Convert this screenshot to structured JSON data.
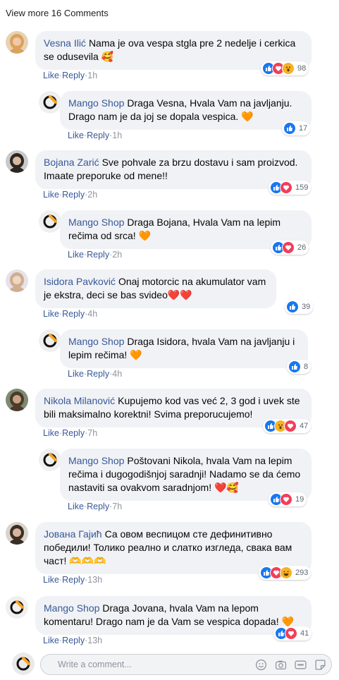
{
  "view_more_label": "View more 16 Comments",
  "action_labels": {
    "like": "Like",
    "reply": "Reply",
    "separator": "·"
  },
  "comments": [
    {
      "author": "Vesna Ilić",
      "text": "Nama je ova vespa stgla pre 2 nedelje i cerkica se odusevila 🥰",
      "time": "1h",
      "reactions": [
        "like",
        "love",
        "wow"
      ],
      "count": "98",
      "avatar": "woman-blonde"
    },
    {
      "author": "Mango Shop",
      "text": "Draga Vesna, Hvala Vam na javljanju. Drago nam je da joj se dopala vespica. 🧡",
      "time": "1h",
      "reactions": [
        "like"
      ],
      "count": "17",
      "avatar": "mango"
    },
    {
      "author": "Bojana Zarić",
      "text": "Sve pohvale za brzu dostavu i sam proizvod. Imaate preporuke od mene!!",
      "time": "2h",
      "reactions": [
        "like",
        "love"
      ],
      "count": "159",
      "avatar": "woman-dark"
    },
    {
      "author": "Mango Shop",
      "text": "Draga Bojana, Hvala Vam na lepim rečima od srca! 🧡",
      "time": "2h",
      "reactions": [
        "like",
        "love"
      ],
      "count": "26",
      "avatar": "mango"
    },
    {
      "author": "Isidora Pavković",
      "text": "Onaj motorcic na akumulator vam je ekstra, deci se bas svideo❤️❤️",
      "time": "4h",
      "reactions": [
        "like"
      ],
      "count": "39",
      "avatar": "woman-light"
    },
    {
      "author": "Mango Shop",
      "text": "Draga Isidora, hvala Vam na javljanju i lepim rečima! 🧡",
      "time": "4h",
      "reactions": [
        "like"
      ],
      "count": "8",
      "avatar": "mango"
    },
    {
      "author": "Nikola Milanović",
      "text": "Kupujemo kod vas već 2, 3 god i uvek ste bili maksimalno korektni! Svima preporucujemo!",
      "time": "7h",
      "reactions": [
        "like",
        "wow",
        "love"
      ],
      "count": "47",
      "avatar": "man"
    },
    {
      "author": "Mango Shop",
      "text": "Poštovani Nikola, hvala Vam na lepim rečima i dugogodišnjoj saradnji! Nadamo se da ćemo nastaviti sa ovakvom saradnjom! ❤️🥰",
      "time": "7h",
      "reactions": [
        "like",
        "love"
      ],
      "count": "19",
      "avatar": "mango"
    },
    {
      "author": "Јована Гајић",
      "text": "Са овом веспицом сте дефинитивно победили! Толико реално и слатко изгледа, свака вам част! 🫶🫶🫶",
      "time": "13h",
      "reactions": [
        "like",
        "love",
        "haha"
      ],
      "count": "293",
      "avatar": "woman-curly"
    },
    {
      "author": "Mango Shop",
      "text": "Draga Jovana, hvala Vam na lepom komentaru! Drago nam je da Vam se vespica dopada! 🧡",
      "time": "13h",
      "reactions": [
        "like",
        "love"
      ],
      "count": "41",
      "avatar": "mango"
    }
  ],
  "composer": {
    "placeholder": "Write a comment..."
  },
  "colors": {
    "link": "#385898",
    "bubble": "#f0f2f5",
    "like": "#1877f2",
    "love": "#f33e58",
    "wow": "#f7b125"
  },
  "icons": [
    "emoji-icon",
    "camera-icon",
    "gif-icon",
    "sticker-icon"
  ]
}
